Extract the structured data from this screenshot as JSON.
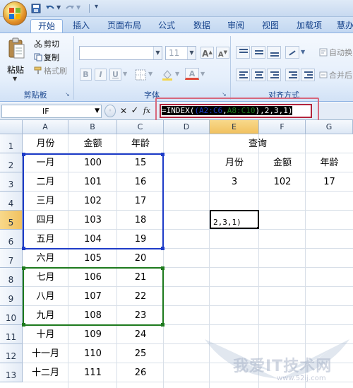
{
  "ribbon_tabs": [
    "开始",
    "插入",
    "页面布局",
    "公式",
    "数据",
    "审阅",
    "视图",
    "加载项",
    "慧办"
  ],
  "active_tab": "开始",
  "clipboard": {
    "paste_label": "粘贴",
    "cut_label": "剪切",
    "copy_label": "复制",
    "format_painter_label": "格式刷",
    "group_label": "剪贴板"
  },
  "font": {
    "font_size_value": "11",
    "grow_font_label": "A",
    "shrink_font_label": "A",
    "bold_label": "B",
    "italic_label": "I",
    "underline_label": "U",
    "font_color_label": "A",
    "group_label": "字体"
  },
  "alignment": {
    "wrap_text_label": "自动换",
    "merge_label": "合并后",
    "group_label": "对齐方式"
  },
  "formula_bar": {
    "name_box": "IF",
    "cancel_symbol": "✕",
    "enter_symbol": "✓",
    "fx_label": "fx",
    "formula_prefix": "=INDEX(",
    "formula_ref1": "(A2:C6",
    "formula_comma": ",",
    "formula_ref2": "A8:C10",
    "formula_suffix": "),2,3,1)"
  },
  "columns": [
    "A",
    "B",
    "C",
    "D",
    "E",
    "F",
    "G"
  ],
  "rows": [
    "1",
    "2",
    "3",
    "4",
    "5",
    "6",
    "7",
    "8",
    "9",
    "10",
    "11",
    "12",
    "13"
  ],
  "table": {
    "headers": [
      "月份",
      "金额",
      "年龄"
    ],
    "rows": [
      [
        "一月",
        "100",
        "15"
      ],
      [
        "二月",
        "101",
        "16"
      ],
      [
        "三月",
        "102",
        "17"
      ],
      [
        "四月",
        "103",
        "18"
      ],
      [
        "五月",
        "104",
        "19"
      ],
      [
        "六月",
        "105",
        "20"
      ],
      [
        "七月",
        "106",
        "21"
      ],
      [
        "八月",
        "107",
        "22"
      ],
      [
        "九月",
        "108",
        "23"
      ],
      [
        "十月",
        "109",
        "24"
      ],
      [
        "十一月",
        "110",
        "25"
      ],
      [
        "十二月",
        "111",
        "26"
      ]
    ]
  },
  "query": {
    "title": "查询",
    "headers": [
      "月份",
      "金额",
      "年龄"
    ],
    "values": [
      "3",
      "102",
      "17"
    ]
  },
  "active_cell_text": "2,3,1)",
  "watermark": {
    "text": "我爱IT技术网",
    "url": "www.52ij.com"
  },
  "colors": {
    "ref1_range": "#1e3cc8",
    "ref2_range": "#1d7a1d",
    "formula_highlight": "#d7677c"
  }
}
